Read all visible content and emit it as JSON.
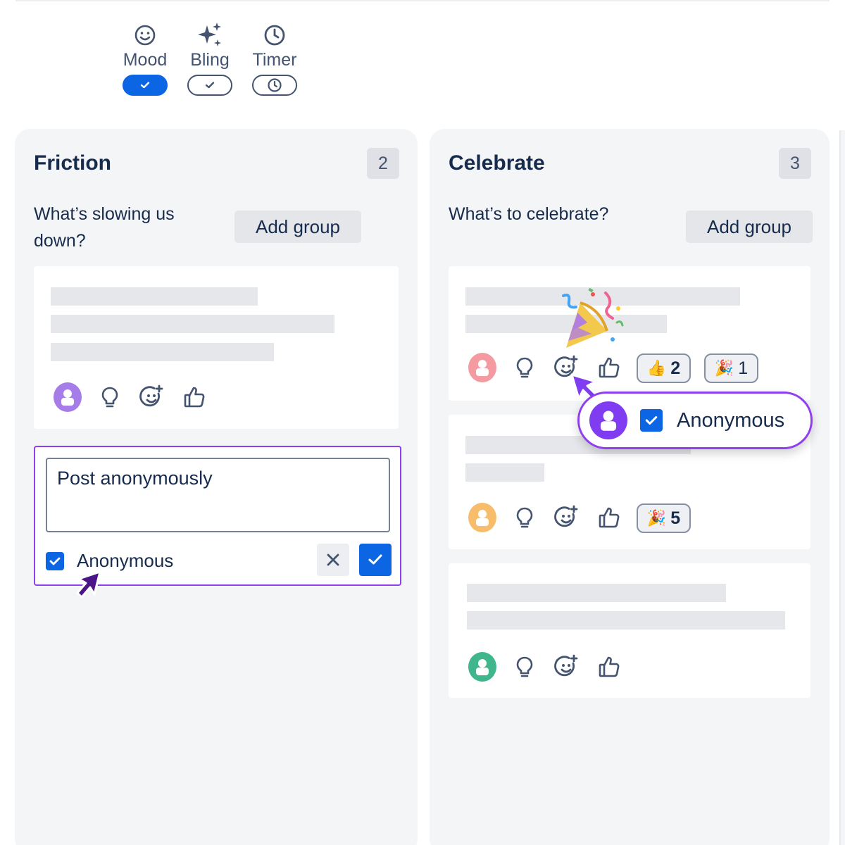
{
  "toolbar": {
    "items": [
      {
        "label": "Mood",
        "state": "on",
        "icon": "smile-icon"
      },
      {
        "label": "Bling",
        "state": "off",
        "icon": "sparkle-icon"
      },
      {
        "label": "Timer",
        "state": "off",
        "icon": "clock-icon"
      }
    ]
  },
  "columns": {
    "friction": {
      "title": "Friction",
      "count": "2",
      "prompt_line1": "What’s slowing us",
      "prompt_line2": "down?",
      "add_group": "Add group"
    },
    "celebrate": {
      "title": "Celebrate",
      "count": "3",
      "prompt": "What’s to celebrate?",
      "add_group": "Add group"
    }
  },
  "editor": {
    "text": "Post anonymously",
    "checkbox_label": "Anonymous",
    "checked": true
  },
  "reactions": {
    "card1_thumbs": {
      "emoji": "👍",
      "count": "2"
    },
    "card1_party": {
      "emoji": "🎉",
      "count": "1"
    },
    "card2_party": {
      "emoji": "🎉",
      "count": "5"
    }
  },
  "bubble": {
    "label": "Anonymous",
    "checked": true
  },
  "confetti_emoji": "🎉",
  "colors": {
    "accent": "#0c66e4",
    "highlight": "#8f3ff0",
    "avatar_purple": "#a57ce8",
    "avatar_pink": "#f39ba0",
    "avatar_orange": "#f7bd6a",
    "avatar_green": "#3fb68b",
    "avatar_violet": "#7f3cf0"
  }
}
